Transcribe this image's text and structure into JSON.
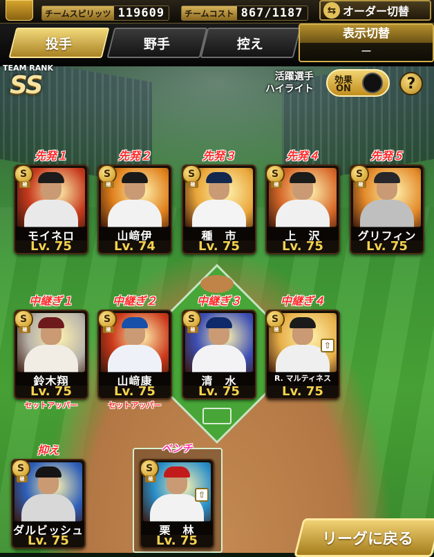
{
  "header": {
    "spirit_label": "チームスピリッツ",
    "spirit_value": "119609",
    "cost_label": "チームコスト",
    "cost_value": "867/1187",
    "order_button": "オーダー切替",
    "order_icon": "swap-arrows-icon"
  },
  "tabs": [
    {
      "label": "投手",
      "active": true
    },
    {
      "label": "野手",
      "active": false
    },
    {
      "label": "控え",
      "active": false
    }
  ],
  "display_toggle": {
    "title": "表示切替",
    "value": "ー"
  },
  "team_rank": {
    "label": "TEAM RANK",
    "value": "SS"
  },
  "highlight": {
    "label_line1": "活躍選手",
    "label_line2": "ハイライト",
    "toggle_label": "効果",
    "toggle_state": "ON"
  },
  "help_label": "?",
  "players": [
    {
      "position": "先発１",
      "name": "モイネロ",
      "level": "Lv. 75",
      "badge": "S",
      "badge_sub": "極",
      "cap": "#1b1b1b",
      "uniform": "#e9e9e9",
      "bg": "#c63a1e"
    },
    {
      "position": "先発２",
      "name": "山﨑伊",
      "level": "Lv. 74",
      "badge": "S",
      "badge_sub": "極",
      "cap": "#1a1a1a",
      "uniform": "#f2f2f2",
      "bg": "#e0801c"
    },
    {
      "position": "先発３",
      "name": "種　市",
      "level": "Lv. 75",
      "badge": "S",
      "badge_sub": "極",
      "cap": "#13284f",
      "uniform": "#f4f4f4",
      "bg": "#e9a63a"
    },
    {
      "position": "先発４",
      "name": "上　沢",
      "level": "Lv. 75",
      "badge": "S",
      "badge_sub": "極",
      "cap": "#1b1b1b",
      "uniform": "#f0f0f0",
      "bg": "#d7692a"
    },
    {
      "position": "先発５",
      "name": "グリフィン",
      "level": "Lv. 75",
      "badge": "S",
      "badge_sub": "極",
      "cap": "#26262b",
      "uniform": "#bfbfbf",
      "bg": "#e38a2a"
    },
    {
      "position": "中継ぎ１",
      "name": "鈴木翔",
      "level": "Lv. 75",
      "badge": "S",
      "badge_sub": "極",
      "cap": "#6e1a1c",
      "uniform": "#f1ece4",
      "bg": "#b8b3aa",
      "subtitle": "セットアッパー"
    },
    {
      "position": "中継ぎ２",
      "name": "山﨑康",
      "level": "Lv. 75",
      "badge": "S",
      "badge_sub": "極",
      "cap": "#1750a8",
      "uniform": "#eef2f8",
      "bg": "#cc3a1c",
      "subtitle": "セットアッパー"
    },
    {
      "position": "中継ぎ３",
      "name": "清　水",
      "level": "Lv. 75",
      "badge": "S",
      "badge_sub": "極",
      "cap": "#0f2a6b",
      "uniform": "#f3f3f5",
      "bg": "#3d4fb5"
    },
    {
      "position": "中継ぎ４",
      "name": "R. マルティネス",
      "level": "Lv. 75",
      "badge": "S",
      "badge_sub": "極",
      "cap": "#1b1b1b",
      "uniform": "#efefef",
      "bg": "#e7b04a",
      "upgrade": true
    },
    {
      "position": "抑え",
      "name": "ダルビッシュ",
      "level": "Lv. 75",
      "badge": "S",
      "badge_sub": "極",
      "cap": "#151515",
      "uniform": "#d8d8d8",
      "bg": "#2e5fb8"
    },
    {
      "position": "ベンチ",
      "name": "栗　林",
      "level": "Lv. 75",
      "badge": "S",
      "badge_sub": "極",
      "cap": "#c21b1b",
      "uniform": "#f2f2f2",
      "bg": "#2a8fc9",
      "upgrade": true
    }
  ],
  "back_button": "リーグに戻る",
  "colors": {
    "accent_gold": "#d4b35a",
    "position_red": "#ff2b2b",
    "level_yellow": "#f3d24f"
  }
}
